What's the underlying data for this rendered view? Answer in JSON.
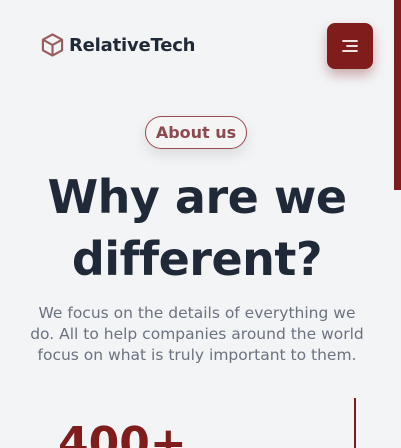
{
  "header": {
    "brand_name": "RelativeTech",
    "logo_icon": "cube-icon",
    "menu_icon": "hamburger-menu-icon"
  },
  "hero": {
    "badge": "About us",
    "title_line1": "Why are we",
    "title_line2": "different?",
    "desc_line1": "We focus on the details of everything we",
    "desc_line2": "do. All to help companies around the world",
    "desc_line3": "focus on what is truly important to them."
  },
  "stats": {
    "first_value": "400+"
  },
  "colors": {
    "accent": "#7f1d1d",
    "text_dark": "#1f2937",
    "text_muted": "#6b7280",
    "background": "#f3f4f6"
  }
}
